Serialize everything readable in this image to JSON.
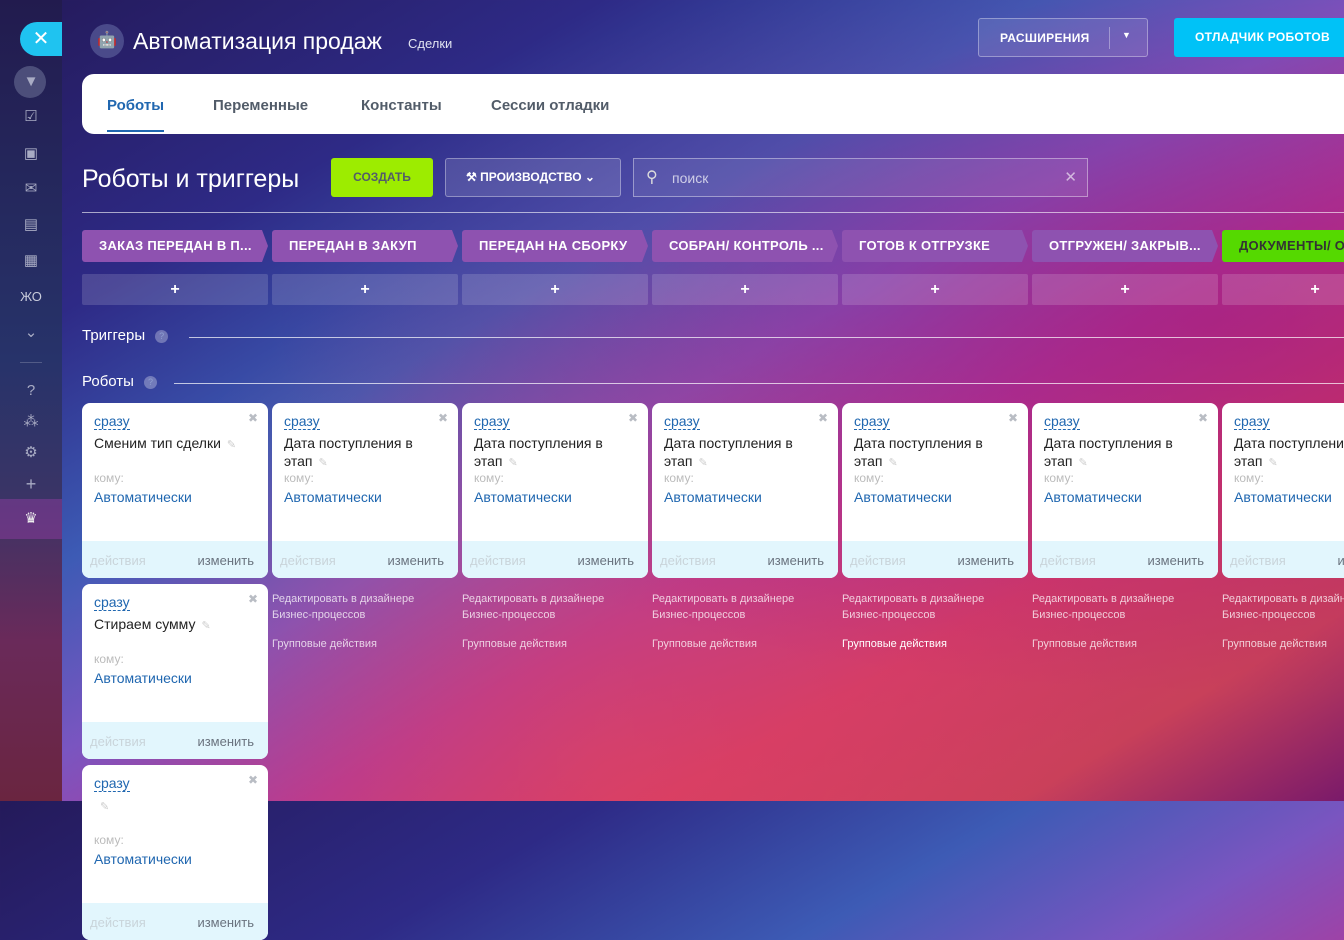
{
  "sidebar": {
    "close": "✕",
    "user_initials": "ЖО"
  },
  "header": {
    "title": "Автоматизация продаж",
    "subtitle": "Сделки",
    "extensions": "РАСШИРЕНИЯ",
    "debugger": "ОТЛАДЧИК РОБОТОВ"
  },
  "tabs": [
    "Роботы",
    "Переменные",
    "Константы",
    "Сессии отладки"
  ],
  "toolbar": {
    "heading": "Роботы и триггеры",
    "create": "СОЗДАТЬ",
    "production": "⚒ ПРОИЗВОДСТВО",
    "search_placeholder": "поиск"
  },
  "sections": {
    "triggers": "Триггеры",
    "robots": "Роботы"
  },
  "stages": [
    {
      "label": "ЗАКАЗ ПЕРЕДАН В П...",
      "color": "#8e52b0"
    },
    {
      "label": "ПЕРЕДАН В ЗАКУП",
      "color": "#8e52b0"
    },
    {
      "label": "ПЕРЕДАН НА СБОРКУ",
      "color": "#8e52b0"
    },
    {
      "label": "СОБРАН/ КОНТРОЛЬ ...",
      "color": "#8e52b0"
    },
    {
      "label": "ГОТОВ К ОТГРУЗКЕ",
      "color": "#8e52b0"
    },
    {
      "label": "ОТГРУЖЕН/ ЗАКРЫВ...",
      "color": "#8e52b0"
    },
    {
      "label": "ДОКУМЕНТЫ/ О",
      "color": "#55d900"
    }
  ],
  "add_label": "+",
  "card_labels": {
    "when": "сразу",
    "to": "кому:",
    "who": "Автоматически",
    "actions": "действия",
    "edit": "изменить"
  },
  "robots": [
    [
      {
        "name": "Сменим тип сделки"
      },
      {
        "name": "Стираем сумму"
      },
      {
        "name": ""
      }
    ],
    [
      {
        "name": "Дата поступления в этап"
      }
    ],
    [
      {
        "name": "Дата поступления в этап"
      }
    ],
    [
      {
        "name": "Дата поступления в этап"
      }
    ],
    [
      {
        "name": "Дата поступления в этап"
      }
    ],
    [
      {
        "name": "Дата поступления в этап"
      }
    ],
    [
      {
        "name": "Дата поступления в этап"
      }
    ]
  ],
  "links": {
    "bp_designer": "Редактировать в дизайнере Бизнес-процессов",
    "group_actions": "Групповые действия"
  }
}
